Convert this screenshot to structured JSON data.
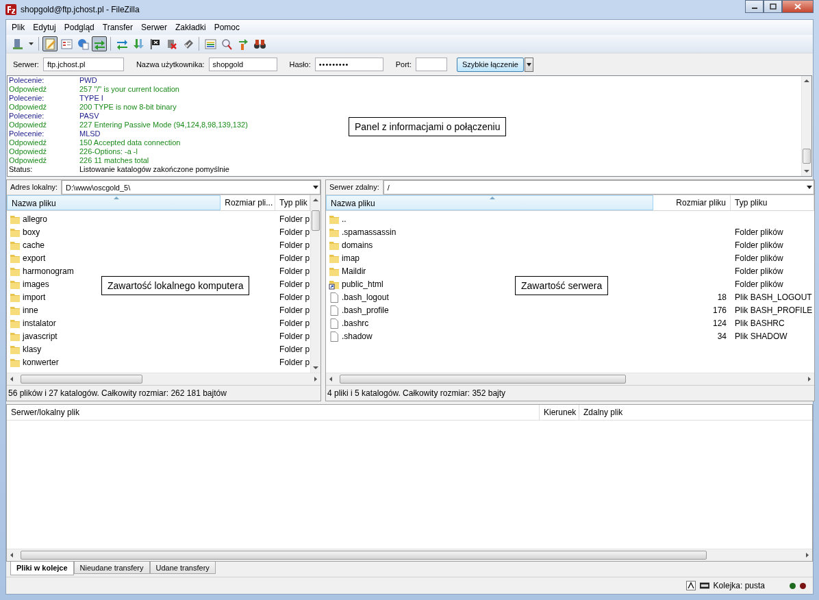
{
  "window": {
    "title": "shopgold@ftp.jchost.pl - FileZilla"
  },
  "menu": [
    "Plik",
    "Edytuj",
    "Podgląd",
    "Transfer",
    "Serwer",
    "Zakładki",
    "Pomoc"
  ],
  "toolbar": [
    {
      "kind": "sitemanager"
    },
    {
      "kind": "dropdown"
    },
    {
      "kind": "separator"
    },
    {
      "kind": "log",
      "pressed": true
    },
    {
      "kind": "localtree",
      "pressed": false
    },
    {
      "kind": "remotetree",
      "pressed": false
    },
    {
      "kind": "queue",
      "pressed": true
    },
    {
      "kind": "separator"
    },
    {
      "kind": "refresh"
    },
    {
      "kind": "process"
    },
    {
      "kind": "flag"
    },
    {
      "kind": "cancel"
    },
    {
      "kind": "reconnect"
    },
    {
      "kind": "separator"
    },
    {
      "kind": "filter"
    },
    {
      "kind": "compare"
    },
    {
      "kind": "sync"
    },
    {
      "kind": "find"
    }
  ],
  "quickconnect": {
    "fields": [
      {
        "label": "Serwer:",
        "value": "ftp.jchost.pl",
        "kind": "text"
      },
      {
        "label": "Nazwa użytkownika:",
        "value": "shopgold",
        "kind": "text"
      },
      {
        "label": "Hasło:",
        "value": "•••••••••",
        "kind": "password"
      },
      {
        "label": "Port:",
        "kind": "port"
      }
    ],
    "button": "Szybkie łączenie"
  },
  "log": {
    "lines": [
      {
        "kind": "command",
        "label": "Polecenie:",
        "text": "PWD"
      },
      {
        "kind": "response",
        "label": "Odpowiedź",
        "text": "257 \"/\" is your current location"
      },
      {
        "kind": "command",
        "label": "Polecenie:",
        "text": "TYPE I"
      },
      {
        "kind": "response",
        "label": "Odpowiedź",
        "text": "200 TYPE is now 8-bit binary"
      },
      {
        "kind": "command",
        "label": "Polecenie:",
        "text": "PASV"
      },
      {
        "kind": "response",
        "label": "Odpowiedź",
        "text": "227 Entering Passive Mode (94,124,8,98,139,132)"
      },
      {
        "kind": "command",
        "label": "Polecenie:",
        "text": "MLSD"
      },
      {
        "kind": "response",
        "label": "Odpowiedź",
        "text": "150 Accepted data connection"
      },
      {
        "kind": "response",
        "label": "Odpowiedź",
        "text": "226-Options: -a -l"
      },
      {
        "kind": "response",
        "label": "Odpowiedź",
        "text": "226 11 matches total"
      },
      {
        "kind": "status",
        "label": "Status:",
        "text": "Listowanie katalogów zakończone pomyślnie"
      }
    ],
    "callout": "Panel z informacjami o połączeniu"
  },
  "local": {
    "address_label": "Adres lokalny:",
    "path": "D:\\www\\oscgold_5\\",
    "columns": [
      {
        "label": "Nazwa pliku",
        "sorted": true
      },
      {
        "label": "Rozmiar pli...",
        "sorted": false
      },
      {
        "label": "Typ plik",
        "sorted": false
      }
    ],
    "rows": [
      {
        "kind": "folder",
        "name": "allegro",
        "type": "Folder p"
      },
      {
        "kind": "folder",
        "name": "boxy",
        "type": "Folder p"
      },
      {
        "kind": "folder",
        "name": "cache",
        "type": "Folder p"
      },
      {
        "kind": "folder",
        "name": "export",
        "type": "Folder p"
      },
      {
        "kind": "folder",
        "name": "harmonogram",
        "type": "Folder p"
      },
      {
        "kind": "folder",
        "name": "images",
        "type": "Folder p"
      },
      {
        "kind": "folder",
        "name": "import",
        "type": "Folder p"
      },
      {
        "kind": "folder",
        "name": "inne",
        "type": "Folder p"
      },
      {
        "kind": "folder",
        "name": "instalator",
        "type": "Folder p"
      },
      {
        "kind": "folder",
        "name": "javascript",
        "type": "Folder p"
      },
      {
        "kind": "folder",
        "name": "klasy",
        "type": "Folder p"
      },
      {
        "kind": "folder",
        "name": "konwerter",
        "type": "Folder p"
      }
    ],
    "callout": "Zawartość lokalnego komputera",
    "status": "56 plików i 27 katalogów. Całkowity rozmiar: 262 181 bajtów"
  },
  "remote": {
    "address_label": "Serwer zdalny:",
    "path": "/",
    "columns": [
      {
        "label": "Nazwa pliku",
        "sorted": true
      },
      {
        "label": "Rozmiar pliku",
        "sorted": false
      },
      {
        "label": "Typ pliku",
        "sorted": false
      }
    ],
    "rows": [
      {
        "kind": "folder",
        "name": ".."
      },
      {
        "kind": "folder",
        "name": ".spamassassin",
        "type": "Folder plików"
      },
      {
        "kind": "folder",
        "name": "domains",
        "type": "Folder plików"
      },
      {
        "kind": "folder",
        "name": "imap",
        "type": "Folder plików"
      },
      {
        "kind": "folder",
        "name": "Maildir",
        "type": "Folder plików"
      },
      {
        "kind": "link",
        "name": "public_html",
        "type": "Folder plików"
      },
      {
        "kind": "file",
        "name": ".bash_logout",
        "size": "18",
        "type": "Plik BASH_LOGOUT"
      },
      {
        "kind": "file",
        "name": ".bash_profile",
        "size": "176",
        "type": "Plik BASH_PROFILE"
      },
      {
        "kind": "file",
        "name": ".bashrc",
        "size": "124",
        "type": "Plik BASHRC"
      },
      {
        "kind": "file",
        "name": ".shadow",
        "size": "34",
        "type": "Plik SHADOW"
      }
    ],
    "callout": "Zawartość serwera",
    "status": "4 pliki i 5 katalogów. Całkowity rozmiar: 352 bajty"
  },
  "queue": {
    "columns": [
      "Serwer/lokalny plik",
      "Kierunek",
      "Zdalny plik"
    ],
    "tabs": [
      {
        "label": "Pliki w kolejce",
        "selected": true
      },
      {
        "label": "Nieudane transfery",
        "selected": false
      },
      {
        "label": "Udane transfery",
        "selected": false
      }
    ]
  },
  "status_bar": {
    "text": "Kolejka: pusta",
    "leds": [
      {
        "color": "#1e6a1e"
      },
      {
        "color": "#7a1414"
      }
    ]
  }
}
